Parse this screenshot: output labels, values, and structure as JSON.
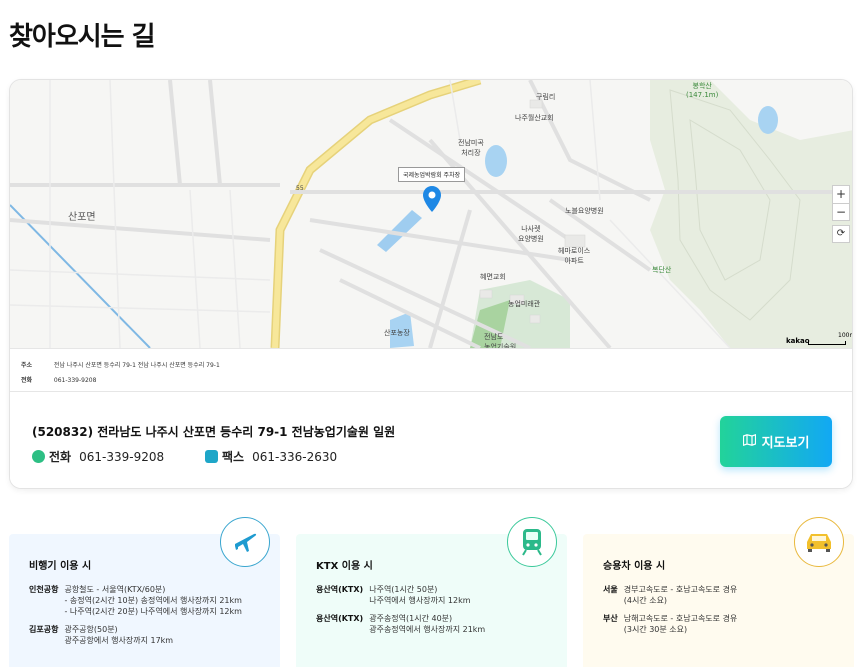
{
  "page": {
    "title": "찾아오시는 길"
  },
  "map": {
    "callout": "국제농업박람회 주차장",
    "labels": {
      "sanpo": "산포면",
      "gurimri": "구림리",
      "naju_church": "나주월산교회",
      "jeonnam_center": "전남미곡\n처리장",
      "nursing": "노블요양병원",
      "nasaret": "나사렛\n요양병원",
      "hemate": "헤마로이스\n아파트",
      "church2": "혜면교회",
      "agri_museum": "농업미래관",
      "nongeop_center": "전남도\n농업기술원",
      "ktx_station": "산포농장",
      "hill1": "봉학산\n(147.1m)",
      "hill2": "복단산",
      "road55": "55"
    },
    "zoom_in": "+",
    "zoom_out": "−",
    "reset": "⟳",
    "logo": "kakao",
    "scale": "100m"
  },
  "map_info": {
    "address_key": "주소",
    "address_value": "전남 나주시 산포면 등수리 79-1 전남 나주시 산포면 등수리 79-1",
    "tel_key": "전화",
    "tel_value": "061-339-9208"
  },
  "address": {
    "title": "(520832) 전라남도 나주시 산포면 등수리 79-1 전남농업기술원 일원",
    "tel_label": "전화",
    "tel_value": "061-339-9208",
    "fax_label": "팩스",
    "fax_value": "061-336-2630",
    "map_button": "지도보기"
  },
  "transport": {
    "air": {
      "title": "비행기 이용 시",
      "icon": "airplane-icon",
      "rows": [
        {
          "key": "인천공항",
          "lines": [
            "공항철도 - 서울역(KTX/60분)",
            "- 송정역(2시간 10분) 송정역에서 행사장까지 21km",
            "- 나주역(2시간 20분) 나주역에서 행사장까지 12km"
          ]
        },
        {
          "key": "김포공항",
          "lines": [
            "광주공항(50분)",
            "광주공항에서 행사장까지 17km"
          ]
        }
      ]
    },
    "ktx": {
      "title": "KTX 이용 시",
      "icon": "train-icon",
      "rows": [
        {
          "key": "용산역(KTX)",
          "lines": [
            "나주역(1시간 50분)",
            "나주역에서 행사장까지 12km"
          ]
        },
        {
          "key": "용산역(KTX)",
          "lines": [
            "광주송정역(1시간 40분)",
            "광주송정역에서 행사장까지 21km"
          ]
        }
      ]
    },
    "car": {
      "title": "승용차 이용 시",
      "icon": "car-icon",
      "rows": [
        {
          "key": "서울",
          "lines": [
            "경부고속도로 - 호남고속도로 경유",
            "(4시간 소요)"
          ]
        },
        {
          "key": "부산",
          "lines": [
            "남해고속도로 - 호남고속도로 경유",
            "(3시간 30분 소요)"
          ]
        }
      ]
    }
  },
  "colors": {
    "accent_green": "#22d39a",
    "accent_blue": "#12a8f4",
    "pin": "#1e88e5"
  }
}
